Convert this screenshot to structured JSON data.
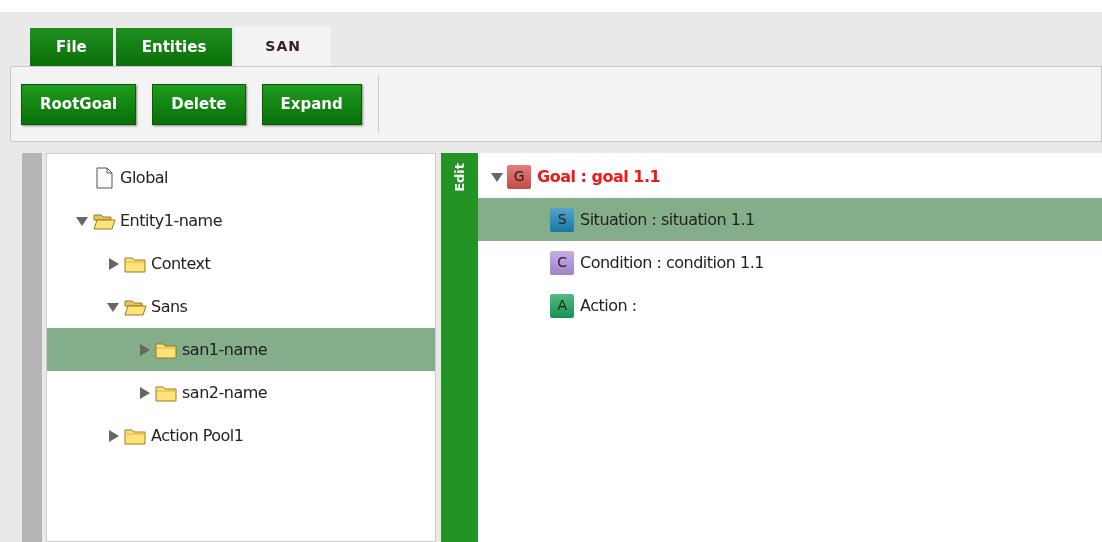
{
  "tabs": [
    {
      "label": "File",
      "selected": false
    },
    {
      "label": "Entities",
      "selected": false
    },
    {
      "label": "SAN",
      "selected": true
    }
  ],
  "toolbar": {
    "buttons": [
      "RootGoal",
      "Delete",
      "Expand"
    ]
  },
  "entity_tree": [
    {
      "label": "Global",
      "kind": "file",
      "selected": false
    },
    {
      "label": "Entity1-name",
      "kind": "folder",
      "expanded": true,
      "selected": false,
      "children": [
        {
          "label": "Context",
          "kind": "folder",
          "expanded": false,
          "selected": false
        },
        {
          "label": "Sans",
          "kind": "folder",
          "expanded": true,
          "selected": false,
          "children": [
            {
              "label": "san1-name",
              "kind": "folder",
              "expanded": false,
              "selected": true
            },
            {
              "label": "san2-name",
              "kind": "folder",
              "expanded": false,
              "selected": false
            }
          ]
        },
        {
          "label": "Action Pool1",
          "kind": "folder",
          "expanded": false,
          "selected": false
        }
      ]
    }
  ],
  "edit_panel": {
    "title": "Edit"
  },
  "goal_tree": [
    {
      "badge": "G",
      "color": "#d9534f",
      "label": "Goal : goal 1.1",
      "highlighted": true,
      "expanded": true,
      "selected": false,
      "children": [
        {
          "badge": "S",
          "color": "#1a86b8",
          "label": "Situation : situation 1.1",
          "highlighted": false,
          "selected": true
        },
        {
          "badge": "C",
          "color": "#b490e0",
          "label": "Condition : condition 1.1",
          "highlighted": false,
          "selected": false
        },
        {
          "badge": "A",
          "color": "#1aa35a",
          "label": "Action :",
          "highlighted": false,
          "selected": false
        }
      ]
    }
  ]
}
